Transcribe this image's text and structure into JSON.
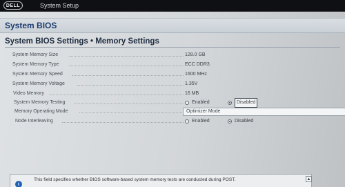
{
  "topbar": {
    "logo_text": "DELL",
    "app_title": "System Setup"
  },
  "header": {
    "title": "System BIOS"
  },
  "section": {
    "title": "System BIOS Settings • Memory Settings"
  },
  "settings": {
    "memory_size": {
      "label": "System Memory Size",
      "value": "128.0 GB"
    },
    "memory_type": {
      "label": "System Memory Type",
      "value": "ECC DDR3"
    },
    "memory_speed": {
      "label": "System Memory Speed",
      "value": "1600 MHz"
    },
    "memory_voltage": {
      "label": "System Memory Voltage",
      "value": "1.35V"
    },
    "video_memory": {
      "label": "Video Memory",
      "value": "16 MB"
    },
    "memory_testing": {
      "label": "System Memory Testing",
      "options": [
        "Enabled",
        "Disabled"
      ],
      "selected": "Disabled"
    },
    "operating_mode": {
      "label": "Memory Operating Mode",
      "value": "Optimizer Mode"
    },
    "node_interleaving": {
      "label": "Node Interleaving",
      "options": [
        "Enabled",
        "Disabled"
      ],
      "selected": "Disabled"
    }
  },
  "help": {
    "icon": "info-icon",
    "icon_glyph": "i",
    "text": "This field specifies whether BIOS software-based system memory tests are conducted during POST.",
    "scroll_glyph": "▲"
  },
  "colors": {
    "topbar": "#0f1013",
    "title_blue": "#1b3b6e",
    "info_blue": "#1f62b3"
  }
}
